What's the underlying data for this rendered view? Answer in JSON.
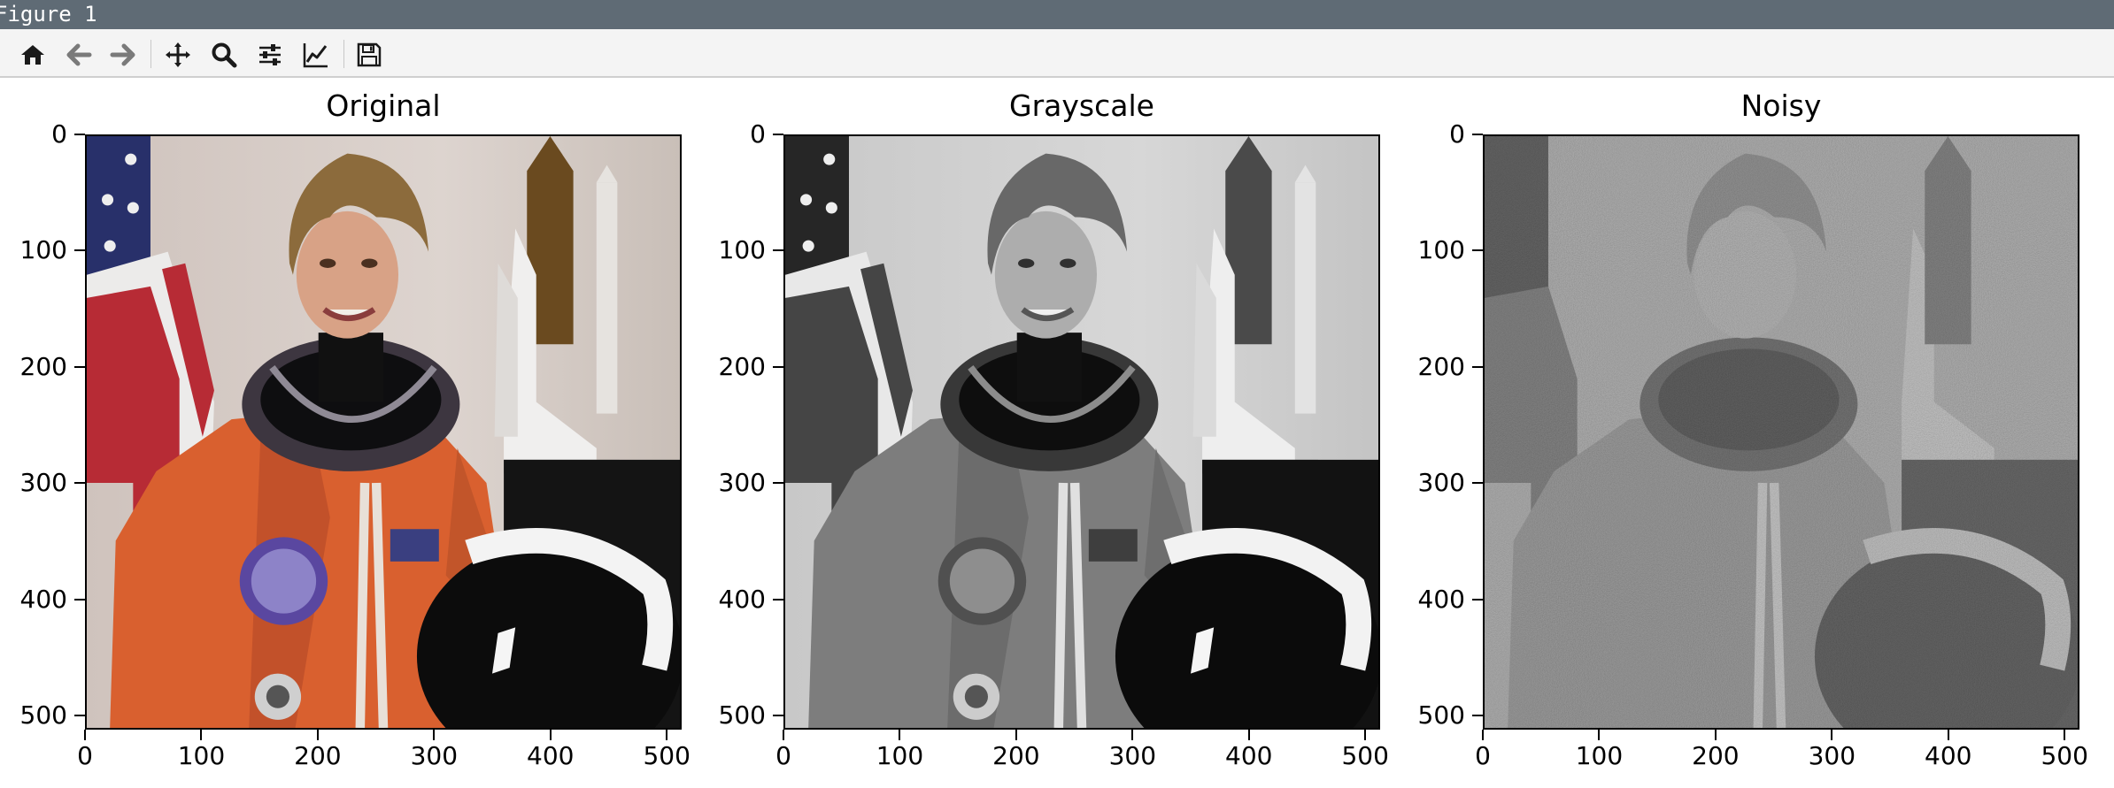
{
  "window": {
    "title": "Figure 1"
  },
  "toolbar": {
    "buttons": [
      {
        "name": "home",
        "icon": "home-icon"
      },
      {
        "name": "back",
        "icon": "arrow-left-icon"
      },
      {
        "name": "forward",
        "icon": "arrow-right-icon"
      },
      {
        "name": "pan",
        "icon": "move-icon"
      },
      {
        "name": "zoom",
        "icon": "search-icon"
      },
      {
        "name": "configure-subplots",
        "icon": "sliders-icon"
      },
      {
        "name": "edit-axes",
        "icon": "line-chart-icon"
      },
      {
        "name": "save",
        "icon": "floppy-disk-icon"
      }
    ]
  },
  "panels": [
    {
      "title": "Original"
    },
    {
      "title": "Grayscale"
    },
    {
      "title": "Noisy"
    }
  ],
  "axis": {
    "y_ticks": [
      "0",
      "100",
      "200",
      "300",
      "400",
      "500"
    ],
    "x_ticks": [
      "0",
      "100",
      "200",
      "300",
      "400",
      "500"
    ],
    "ylim": [
      0,
      512
    ],
    "xlim": [
      0,
      512
    ]
  },
  "colors": {
    "titlebar": "#5f6b75",
    "toolbar": "#f4f4f4",
    "suit_orange": "#d9602f"
  }
}
